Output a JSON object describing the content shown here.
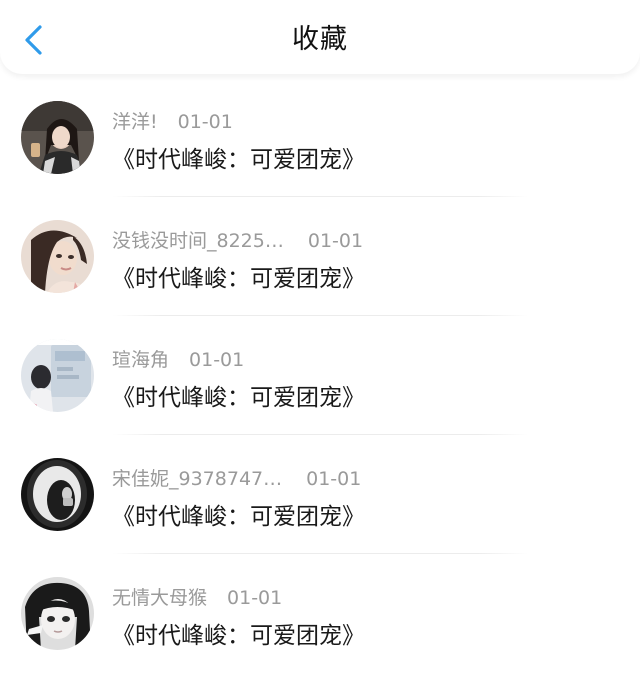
{
  "header": {
    "title": "收藏",
    "back_icon": "chevron-left-icon",
    "accent_color": "#2f9bea"
  },
  "favorites": [
    {
      "username": "洋洋!",
      "date": "01-01",
      "work_title": "《时代峰峻：可爱团宠》",
      "avatar": "avatar-photo"
    },
    {
      "username": "没钱没时间_8225…",
      "date": "01-01",
      "work_title": "《时代峰峻：可爱团宠》",
      "avatar": "avatar-photo"
    },
    {
      "username": "瑄海角",
      "date": "01-01",
      "work_title": "《时代峰峻：可爱团宠》",
      "avatar": "avatar-photo"
    },
    {
      "username": "宋佳妮_9378747…",
      "date": "01-01",
      "work_title": "《时代峰峻：可爱团宠》",
      "avatar": "avatar-photo"
    },
    {
      "username": "无情大母猴",
      "date": "01-01",
      "work_title": "《时代峰峻：可爱团宠》",
      "avatar": "avatar-photo"
    }
  ]
}
